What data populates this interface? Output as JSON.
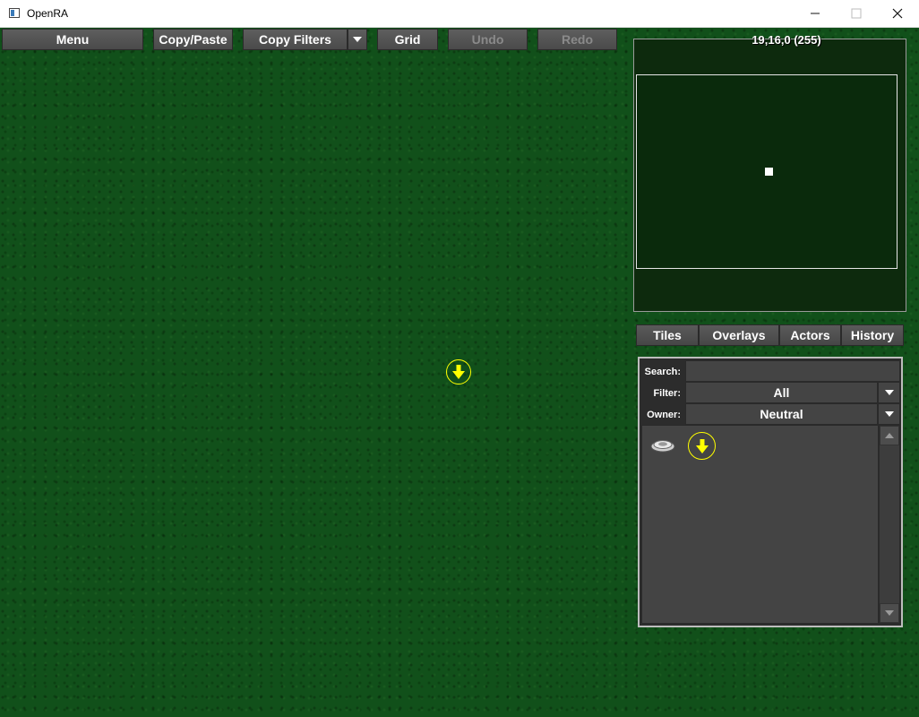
{
  "window": {
    "title": "OpenRA"
  },
  "toolbar": {
    "menu": "Menu",
    "copy_paste": "Copy/Paste",
    "copy_filters": "Copy Filters",
    "grid": "Grid",
    "undo": "Undo",
    "redo": "Redo"
  },
  "minimap": {
    "coords": "19,16,0 (255)"
  },
  "tabs": [
    "Tiles",
    "Overlays",
    "Actors",
    "History"
  ],
  "actors_panel": {
    "search_label": "Search:",
    "search_value": "",
    "filter_label": "Filter:",
    "filter_value": "All",
    "owner_label": "Owner:",
    "owner_value": "Neutral"
  },
  "icons": {
    "marker": "yellow-down-arrow-icon",
    "mine": "mine-icon"
  },
  "colors": {
    "marker": "#ffff00",
    "button_bg": "#4f4f4f",
    "map_green": "#11501a"
  }
}
